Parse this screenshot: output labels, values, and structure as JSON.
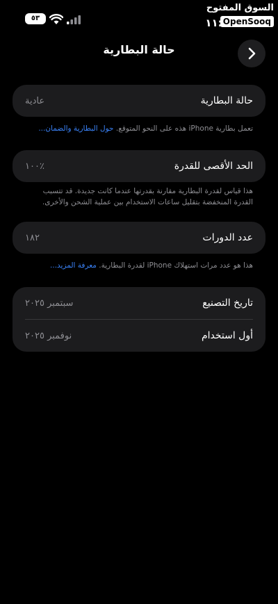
{
  "status_bar": {
    "time": "١١:٠٥",
    "battery": "٥٣",
    "watermark_ar": "السوق المفتوح",
    "watermark_en": "OpenSooq"
  },
  "header": {
    "title": "حالة البطارية"
  },
  "battery_condition": {
    "label": "حالة البطارية",
    "value": "عادية",
    "note": "تعمل بطارية iPhone هذه على النحو المتوقع.",
    "note_link": "حول البطارية والضمان..."
  },
  "max_capacity": {
    "label": "الحد الأقصى للقدرة",
    "value": "٪١٠٠",
    "note": "هذا قياس لقدرة البطارية مقارنة بقدرتها عندما كانت جديدة. قد تتسبب القدرة المنخفضة بتقليل ساعات الاستخدام بين عملية الشحن والأخرى."
  },
  "cycle_count": {
    "label": "عدد الدورات",
    "value": "١٨٢",
    "note": "هذا هو عدد مرات استهلاك iPhone لقدرة البطارية.",
    "note_link": "معرفة المزيد..."
  },
  "dates": {
    "manufacture_label": "تاريخ التصنيع",
    "manufacture_value": "سبتمبر ٢٠٢٥",
    "first_use_label": "أول استخدام",
    "first_use_value": "نوفمبر ٢٠٢٥"
  },
  "colors": {
    "background": "#000000",
    "card": "#1c1c1e",
    "link": "#3a82f7",
    "secondary_text": "#8e8e93"
  }
}
